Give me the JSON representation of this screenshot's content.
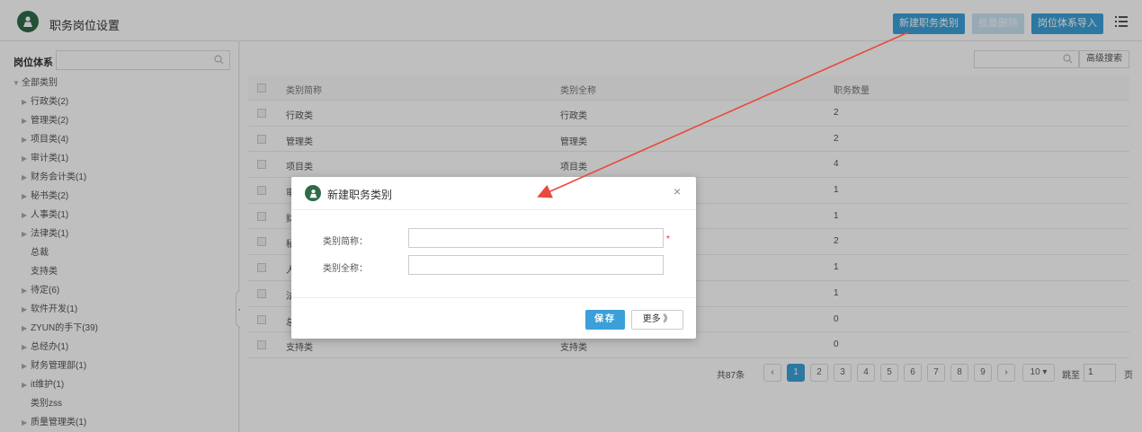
{
  "header": {
    "title": "职务岗位设置",
    "btn_new_category": "新建职务类别",
    "btn_batch_delete": "批量删除",
    "btn_import": "岗位体系导入"
  },
  "left": {
    "label": "岗位体系",
    "tree": [
      {
        "label": "全部类别",
        "arrow": "▼",
        "indent": 0
      },
      {
        "label": "行政类(2)",
        "arrow": "▶",
        "indent": 1
      },
      {
        "label": "管理类(2)",
        "arrow": "▶",
        "indent": 1
      },
      {
        "label": "项目类(4)",
        "arrow": "▶",
        "indent": 1
      },
      {
        "label": "审计类(1)",
        "arrow": "▶",
        "indent": 1
      },
      {
        "label": "财务会计类(1)",
        "arrow": "▶",
        "indent": 1
      },
      {
        "label": "秘书类(2)",
        "arrow": "▶",
        "indent": 1
      },
      {
        "label": "人事类(1)",
        "arrow": "▶",
        "indent": 1
      },
      {
        "label": "法律类(1)",
        "arrow": "▶",
        "indent": 1
      },
      {
        "label": "总裁",
        "arrow": "",
        "indent": 1
      },
      {
        "label": "支持类",
        "arrow": "",
        "indent": 1
      },
      {
        "label": "待定(6)",
        "arrow": "▶",
        "indent": 1
      },
      {
        "label": "软件开发(1)",
        "arrow": "▶",
        "indent": 1
      },
      {
        "label": "ZYUN的手下(39)",
        "arrow": "▶",
        "indent": 1
      },
      {
        "label": "总经办(1)",
        "arrow": "▶",
        "indent": 1
      },
      {
        "label": "财务管理部(1)",
        "arrow": "▶",
        "indent": 1
      },
      {
        "label": "it维护(1)",
        "arrow": "▶",
        "indent": 1
      },
      {
        "label": "类别zss",
        "arrow": "",
        "indent": 1
      },
      {
        "label": "质量管理类(1)",
        "arrow": "▶",
        "indent": 1
      }
    ]
  },
  "right": {
    "adv_search": "高级搜索",
    "columns": [
      "类别简称",
      "类别全称",
      "职务数量"
    ],
    "rows": [
      [
        "行政类",
        "行政类",
        "2"
      ],
      [
        "管理类",
        "管理类",
        "2"
      ],
      [
        "项目类",
        "项目类",
        "4"
      ],
      [
        "审",
        "",
        "1"
      ],
      [
        "财",
        "",
        "1"
      ],
      [
        "秘",
        "",
        "2"
      ],
      [
        "人",
        "",
        "1"
      ],
      [
        "法",
        "",
        "1"
      ],
      [
        "总",
        "",
        "0"
      ],
      [
        "支持类",
        "支持类",
        "0"
      ]
    ]
  },
  "pager": {
    "total": "共87条",
    "prev": "‹",
    "pages": [
      "1",
      "2",
      "3",
      "4",
      "5",
      "6",
      "7",
      "8",
      "9"
    ],
    "next": "›",
    "page_size": "10 ▾",
    "goto": "跳至",
    "goto_value": "1",
    "page_unit": "页"
  },
  "modal": {
    "title": "新建职务类别",
    "close": "×",
    "label_short": "类别简称：",
    "label_full": "类别全称：",
    "required_mark": "*",
    "save": "保存",
    "more": "更多 》"
  },
  "colors": {
    "accent": "#3ba0d9",
    "logo": "#2f6b48",
    "annotation_arrow": "#e84a3b"
  }
}
